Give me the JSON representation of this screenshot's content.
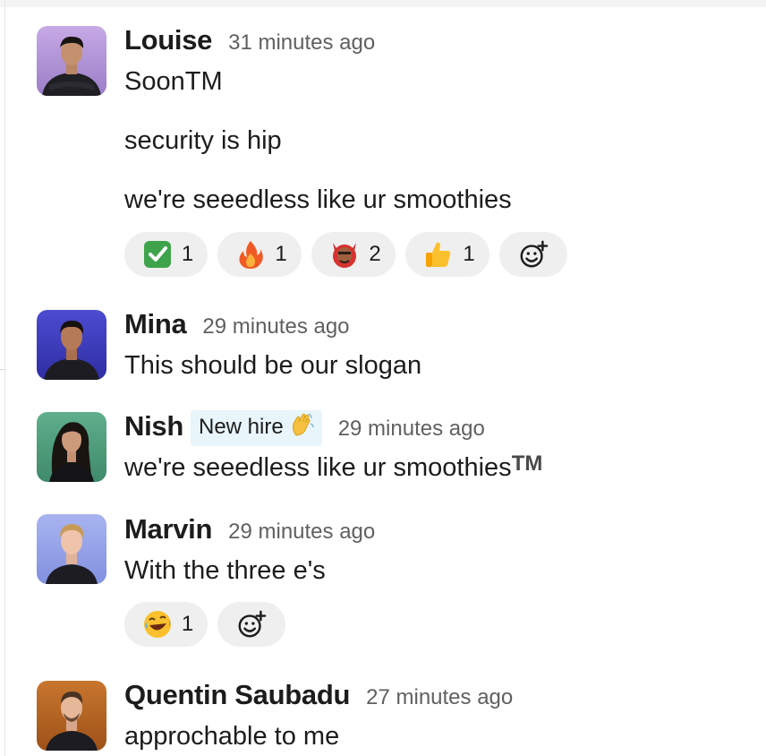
{
  "messages": [
    {
      "author": "Louise",
      "time": "31 minutes ago",
      "lines": [
        "SoonTM",
        "security is hip",
        "we're seeedless like ur smoothies"
      ],
      "reactions": [
        {
          "icon": "check-mark-icon",
          "count": "1"
        },
        {
          "icon": "fire-icon",
          "count": "1"
        },
        {
          "icon": "devil-face-icon",
          "count": "2"
        },
        {
          "icon": "thumbs-up-icon",
          "count": "1"
        }
      ]
    },
    {
      "author": "Mina",
      "time": "29 minutes ago",
      "lines": [
        "This should be our slogan"
      ]
    },
    {
      "author": "Nish",
      "badge": "New hire",
      "badge_icon": "waving-hand-icon",
      "time": "29 minutes ago",
      "lines": [
        "we're seeedless like ur smoothies"
      ],
      "suffix": "TM"
    },
    {
      "author": "Marvin",
      "time": "29 minutes ago",
      "lines": [
        "With the three e's"
      ],
      "reactions": [
        {
          "icon": "rolling-laughing-icon",
          "count": "1"
        }
      ]
    },
    {
      "author": "Quentin Saubadu",
      "time": "27 minutes ago",
      "lines": [
        "approchable to me"
      ]
    }
  ],
  "colors": {
    "author": "#1d1c1d",
    "timestamp": "#616061",
    "reaction_bg": "#efefef",
    "badge_bg": "#e8f5fa"
  },
  "add_reaction_icon": "add-reaction-icon"
}
